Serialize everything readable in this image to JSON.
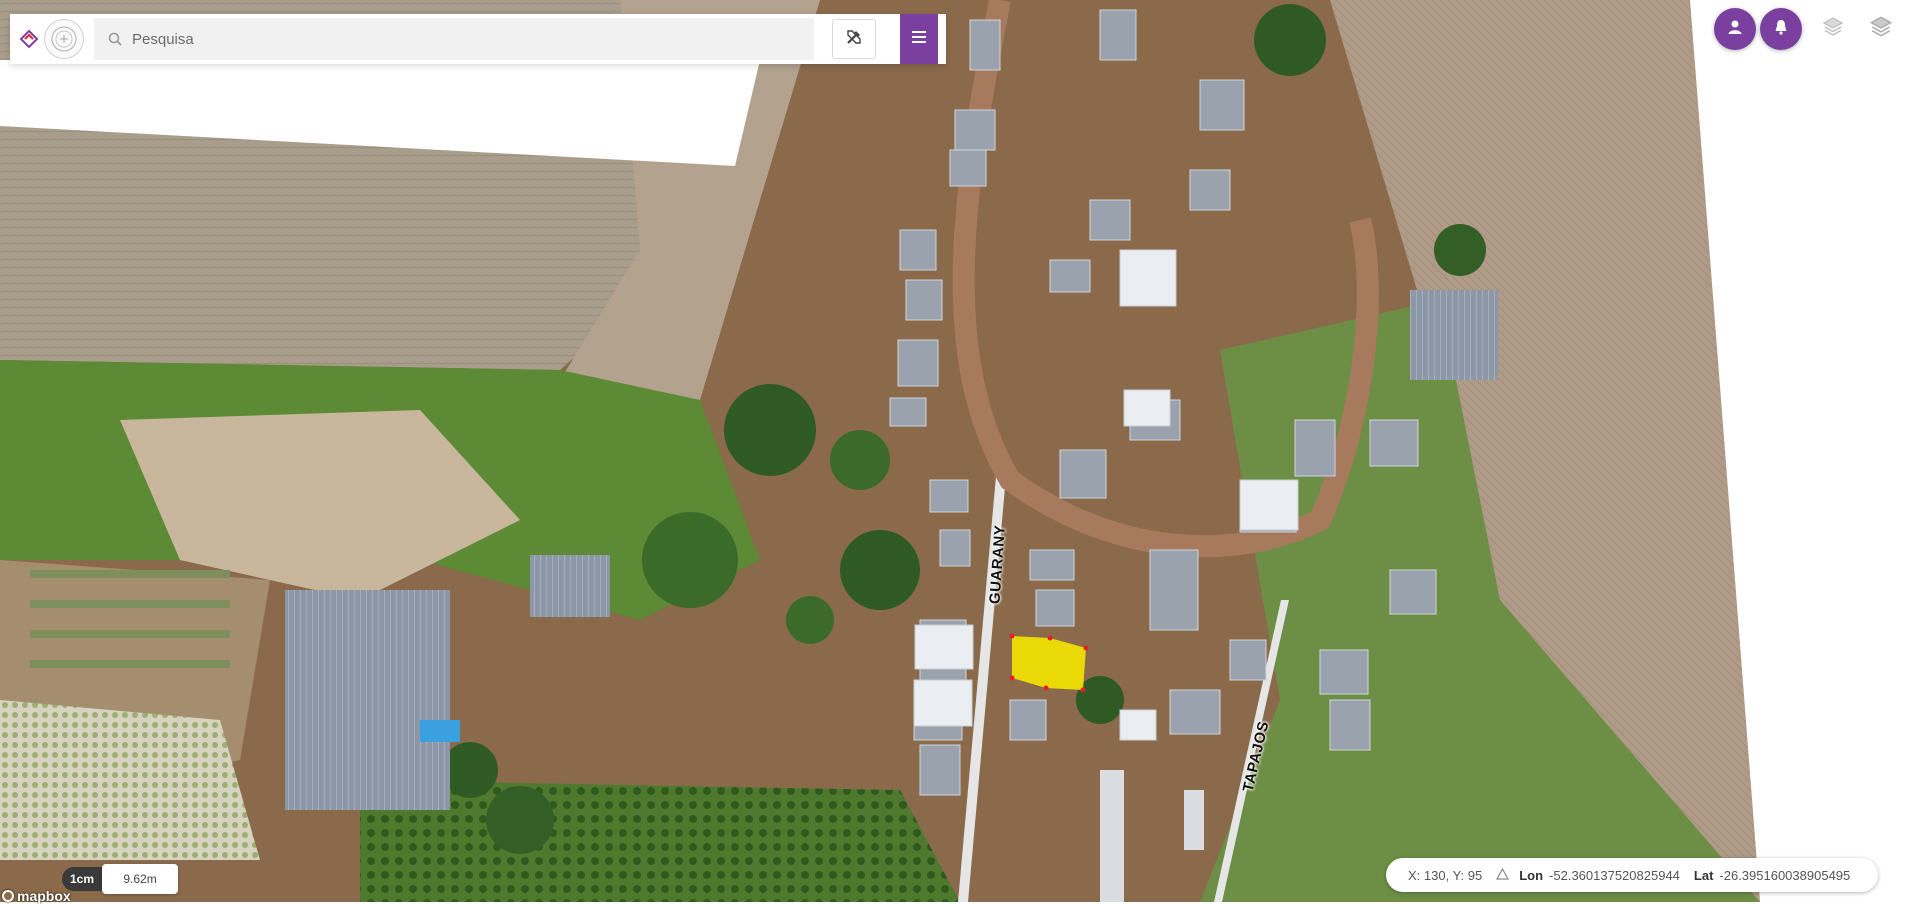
{
  "search": {
    "placeholder": "Pesquisa",
    "value": ""
  },
  "icons": {
    "logo": "app-logo-icon",
    "seal": "org-seal-icon",
    "search": "search-icon",
    "tools": "tools-icon",
    "menu": "hamburger-menu-icon",
    "user": "user-icon",
    "notifications": "bell-icon",
    "layers_outline": "layers-outline-icon",
    "layers": "layers-icon"
  },
  "colors": {
    "accent": "#7b3fa0",
    "selection": "#f2e600",
    "selection_vertex": "#e0202a"
  },
  "map": {
    "streets": [
      "GUARANY",
      "TAPAJOS"
    ],
    "scale": {
      "unit": "1cm",
      "value": "9.62m"
    },
    "attribution": "mapbox",
    "cursor": {
      "xy_label": "X: 130, Y: 95",
      "lon_label": "Lon",
      "lon_value": "-52.360137520825944",
      "lat_label": "Lat",
      "lat_value": "-26.395160038905495"
    }
  }
}
